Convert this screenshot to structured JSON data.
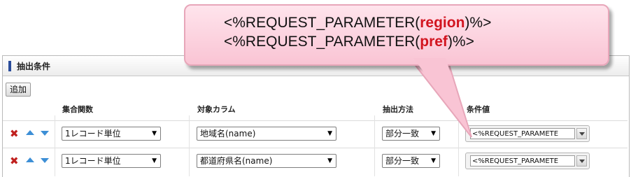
{
  "panel": {
    "title": "抽出条件"
  },
  "add_button": "追加",
  "columns": {
    "aggregate": "集合関数",
    "target": "対象カラム",
    "method": "抽出方法",
    "value": "条件値"
  },
  "rows": [
    {
      "delete": "✖",
      "aggregate": "1レコード単位",
      "target": "地域名(name)",
      "method": "部分一致",
      "value": "<%REQUEST_PARAMETE"
    },
    {
      "delete": "✖",
      "aggregate": "1レコード単位",
      "target": "都道府県名(name)",
      "method": "部分一致",
      "value": "<%REQUEST_PARAMETE"
    }
  ],
  "callout": {
    "line1_prefix": "<%REQUEST_PARAMETER(",
    "line1_param": "region",
    "line1_suffix": ")%>",
    "line2_prefix": "<%REQUEST_PARAMETER(",
    "line2_param": "pref",
    "line2_suffix": ")%>"
  },
  "colors": {
    "accent_bar": "#2a4c9a",
    "delete_red": "#c0211f",
    "arrow_blue": "#3d8fd6",
    "callout_pink": "#f9c4d4",
    "param_red": "#d2141f"
  }
}
